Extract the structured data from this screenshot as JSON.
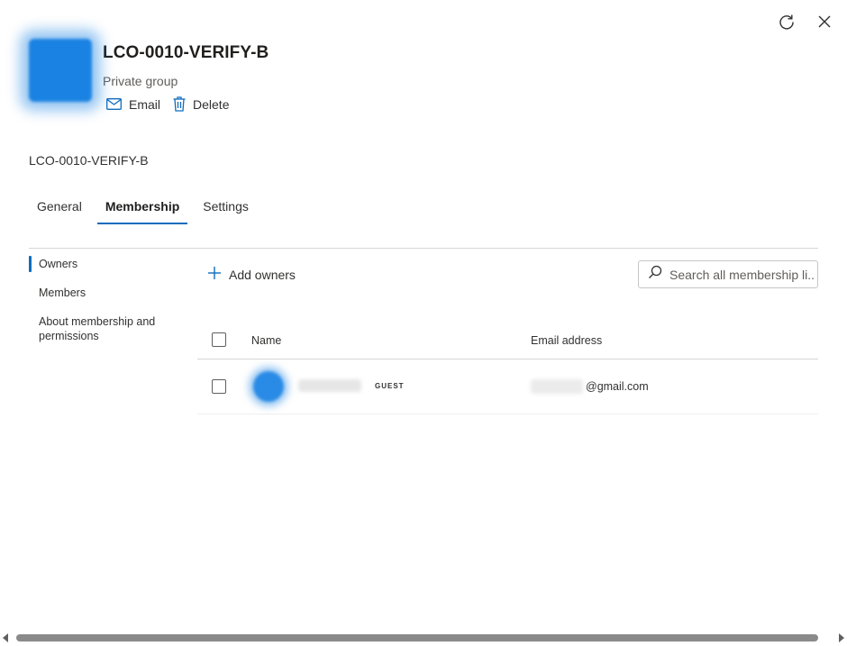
{
  "panel": {
    "title": "LCO-0010-VERIFY-B",
    "subtitle": "Private group",
    "actions": {
      "email_label": "Email",
      "delete_label": "Delete"
    },
    "group_name": "LCO-0010-VERIFY-B"
  },
  "tabs": [
    {
      "label": "General",
      "active": false
    },
    {
      "label": "Membership",
      "active": true
    },
    {
      "label": "Settings",
      "active": false
    }
  ],
  "side_nav": [
    {
      "label": "Owners",
      "active": true
    },
    {
      "label": "Members",
      "active": false
    },
    {
      "label": "About membership and permissions",
      "active": false
    }
  ],
  "toolbar": {
    "add_label": "Add owners",
    "search_placeholder": "Search all membership li..."
  },
  "table": {
    "columns": [
      "Name",
      "Email address"
    ],
    "rows": [
      {
        "badge": "GUEST",
        "email_suffix": "@gmail.com"
      }
    ]
  },
  "colors": {
    "accent": "#0f6cbd",
    "avatar": "#1a82e2"
  },
  "icons": {
    "refresh": "refresh-icon",
    "close": "close-icon",
    "email": "mail-icon",
    "delete": "trash-icon",
    "add": "plus-icon",
    "search": "search-icon"
  }
}
